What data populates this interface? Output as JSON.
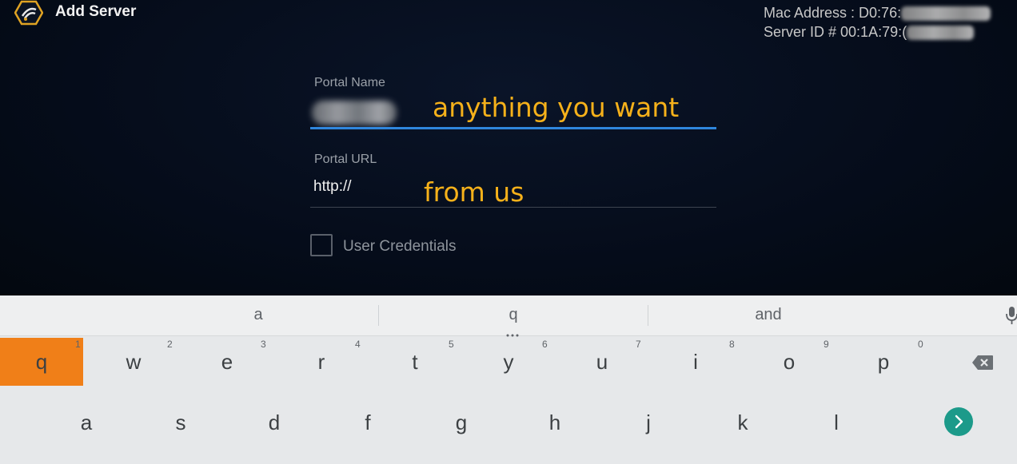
{
  "app": {
    "title": "Add Server",
    "mac_address_label": "Mac Address : D0:76:",
    "server_id_label": "Server ID # 00:1A:79:("
  },
  "form": {
    "portal_name_label": "Portal Name",
    "portal_url_label": "Portal URL",
    "portal_url_value": "http://",
    "user_credentials_label": "User Credentials",
    "user_credentials_checked": false
  },
  "annotations": {
    "portal_name_note": "anything you want",
    "portal_url_note": "from us"
  },
  "keyboard": {
    "suggestions": [
      "a",
      "q",
      "and"
    ],
    "row1": [
      {
        "key": "q",
        "hint": "1",
        "active": true
      },
      {
        "key": "w",
        "hint": "2"
      },
      {
        "key": "e",
        "hint": "3"
      },
      {
        "key": "r",
        "hint": "4"
      },
      {
        "key": "t",
        "hint": "5"
      },
      {
        "key": "y",
        "hint": "6"
      },
      {
        "key": "u",
        "hint": "7"
      },
      {
        "key": "i",
        "hint": "8"
      },
      {
        "key": "o",
        "hint": "9"
      },
      {
        "key": "p",
        "hint": "0"
      }
    ],
    "row2": [
      "a",
      "s",
      "d",
      "f",
      "g",
      "h",
      "j",
      "k",
      "l"
    ],
    "colors": {
      "active_key": "#f07f18",
      "enter": "#1c9a8a",
      "accent_line": "#2f86dd",
      "annotation": "#f6b11a"
    }
  }
}
